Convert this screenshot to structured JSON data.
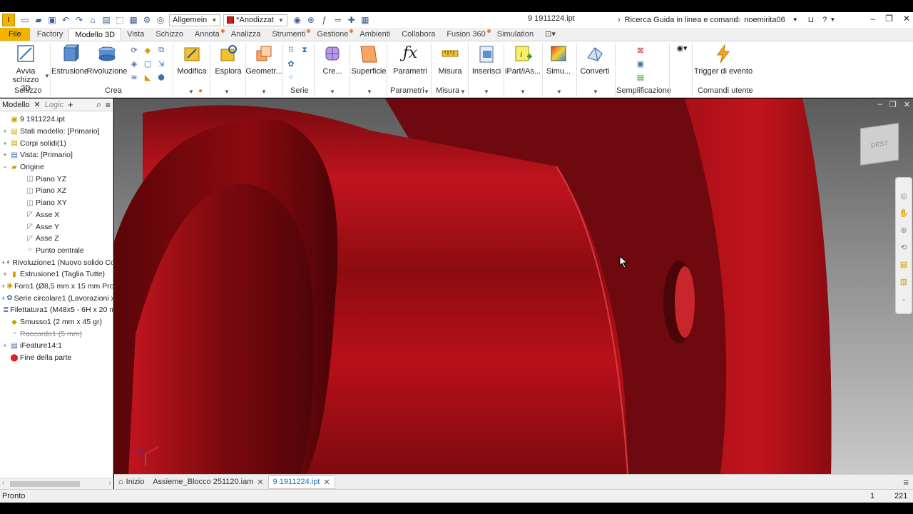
{
  "app_badge": "I",
  "quick_access": {
    "style_select": "Allgemein",
    "appearance_select": "*Anodizzat"
  },
  "document_title": "9 1911224.ipt",
  "help_search_placeholder": "Ricerca Guida in linea e comand",
  "user_name": "noemirita06",
  "tabs": [
    {
      "label": "File"
    },
    {
      "label": "Factory"
    },
    {
      "label": "Modello 3D"
    },
    {
      "label": "Vista"
    },
    {
      "label": "Schizzo"
    },
    {
      "label": "Annota"
    },
    {
      "label": "Analizza"
    },
    {
      "label": "Strumenti"
    },
    {
      "label": "Gestione"
    },
    {
      "label": "Ambienti"
    },
    {
      "label": "Collabora"
    },
    {
      "label": "Fusion 360"
    },
    {
      "label": "Simulation"
    }
  ],
  "ribbon": {
    "start_sketch": {
      "line1": "Avvia",
      "line2": "schizzo 2D"
    },
    "extrude": "Estrusione",
    "revolve": "Rivoluzione",
    "modify": "Modifica",
    "explore": "Esplora",
    "geometry": "Geometr...",
    "create_freeform": "Cre...",
    "surface": "Superficie",
    "parameters": "Parametri",
    "measure": "Misura",
    "insert": "Inserisci",
    "ipart": "iPart/iAs...",
    "simulation": "Simu...",
    "convert": "Converti",
    "event_trigger": "Trigger di evento",
    "groups": {
      "sketch": "Schizzo",
      "create": "Crea",
      "pattern": "Serie",
      "parameters": "Parametri",
      "measure": "Misura",
      "simplification": "Semplificazione",
      "user_commands": "Comandi utente"
    }
  },
  "browser": {
    "tab_model": "Modello",
    "tab_logic": "Logic",
    "nodes": [
      {
        "label": "9 1911224.ipt",
        "level": 0,
        "toggle": ""
      },
      {
        "label": "Stati modello: [Primario]",
        "level": 0,
        "toggle": "+"
      },
      {
        "label": "Corpi solidi(1)",
        "level": 0,
        "toggle": "+"
      },
      {
        "label": "Vista: [Primario]",
        "level": 0,
        "toggle": "+"
      },
      {
        "label": "Origine",
        "level": 0,
        "toggle": "−"
      },
      {
        "label": "Piano YZ",
        "level": 1,
        "toggle": ""
      },
      {
        "label": "Piano XZ",
        "level": 1,
        "toggle": ""
      },
      {
        "label": "Piano XY",
        "level": 1,
        "toggle": ""
      },
      {
        "label": "Asse X",
        "level": 1,
        "toggle": ""
      },
      {
        "label": "Asse Y",
        "level": 1,
        "toggle": ""
      },
      {
        "label": "Asse Z",
        "level": 1,
        "toggle": ""
      },
      {
        "label": "Punto centrale",
        "level": 1,
        "toggle": ""
      },
      {
        "label": "Rivoluzione1 (Nuovo solido Com",
        "level": 0,
        "toggle": "+"
      },
      {
        "label": "Estrusione1 (Taglia Tutte)",
        "level": 0,
        "toggle": "+"
      },
      {
        "label": "Foro1 (Ø8,5 mm x 15 mm Profor",
        "level": 0,
        "toggle": "+"
      },
      {
        "label": "Serie circolare1 (Lavorazioni x 3",
        "level": 0,
        "toggle": "+"
      },
      {
        "label": "Filettatura1 (M48x5 - 6H x 20 m",
        "level": 0,
        "toggle": ""
      },
      {
        "label": "Smusso1 (2 mm x 45 gr)",
        "level": 0,
        "toggle": ""
      },
      {
        "label": "Raccordo1 (5 mm)",
        "level": 0,
        "toggle": "",
        "strike": true
      },
      {
        "label": "iFeature14:1",
        "level": 0,
        "toggle": "+"
      },
      {
        "label": "Fine della parte",
        "level": 0,
        "toggle": ""
      }
    ]
  },
  "viewcube_label": "DEST",
  "doc_tabs": [
    {
      "label": "Inizio",
      "active": false,
      "closable": false
    },
    {
      "label": "Assieme_Blocco 251120.iam",
      "active": false,
      "closable": true
    },
    {
      "label": "9 1911224.ipt",
      "active": true,
      "closable": true
    }
  ],
  "status": {
    "text": "Pronto",
    "count1": "1",
    "count2": "221"
  },
  "colors": {
    "part_red": "#b5121b",
    "accent_orange": "#f0b400"
  }
}
